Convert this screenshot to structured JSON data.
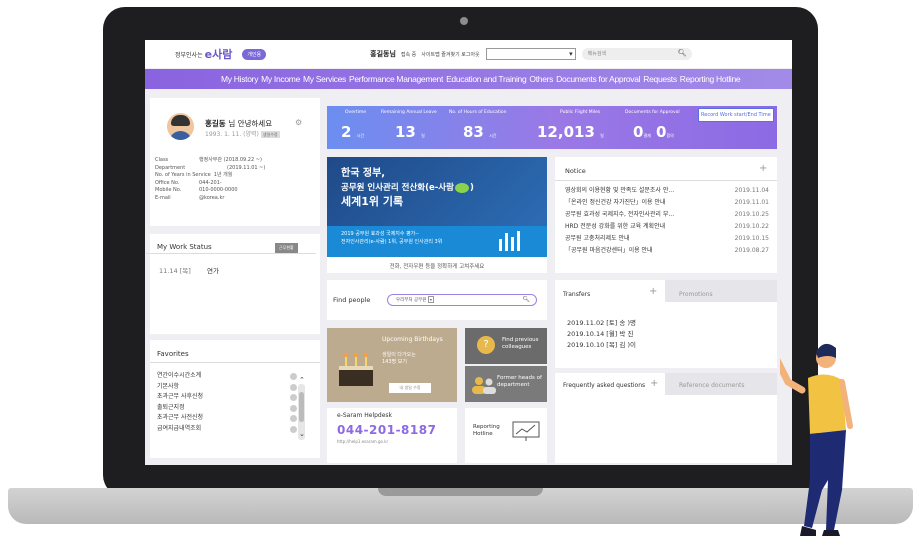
{
  "header": {
    "logo_prefix": "정부인사는",
    "logo": "e사람",
    "badge": "개인용",
    "user": "홍길동님",
    "user_suffix": "접속 중",
    "links": "사이트맵  즐겨찾기  로그아웃",
    "select_placeholder": "",
    "search_placeholder": "메뉴검색"
  },
  "nav": {
    "items": [
      "My History",
      "My Income",
      "My Services",
      "Performance Management",
      "Education and Training",
      "Others",
      "Documents for Approval",
      "Requests",
      "Reporting Hotline"
    ]
  },
  "profile": {
    "name": "홍길동",
    "greeting": "님 안녕하세요",
    "birth": "1993. 1. 11. (양력)",
    "birth_tag": "생일수정",
    "rows": [
      {
        "label": "Class",
        "value": "행정사무관 (2018.09.22 ~)"
      },
      {
        "label": "Department",
        "value": "(2019.11.01 ~)"
      },
      {
        "label": "No. of Years in Service",
        "value": "1년 개월"
      },
      {
        "label": "Office No.",
        "value": "044-201-"
      },
      {
        "label": "Mobile No.",
        "value": "010-0000-0000"
      },
      {
        "label": "E-mail",
        "value": "@korea.kr"
      }
    ]
  },
  "work_status": {
    "title": "My Work Status",
    "button": "근무현황",
    "date": "11.14 [목]",
    "status": "연가"
  },
  "favorites": {
    "title": "Favorites",
    "items": [
      "연간이수시간소계",
      "기본사항",
      "초과근무 사후신청",
      "출퇴근지정",
      "초과근무 사전신청",
      "급여지급내역조회"
    ]
  },
  "stats": {
    "overtime_label": "Overtime",
    "overtime": "2",
    "overtime_unit": "시간",
    "leave_label": "Remaining Annual Leave",
    "leave": "13",
    "leave_unit": "일",
    "edu_label": "No. of Hours of Education",
    "edu": "83",
    "edu_unit": "시간",
    "miles_label": "Public Flight Miles",
    "miles": "12,013",
    "miles_unit": "일",
    "approval_label": "Documents for Approval",
    "approval_a": "0",
    "approval_a_unit": "결재",
    "approval_b": "0",
    "approval_b_unit": "합의",
    "record_button": "Record Work start/End Time"
  },
  "banner": {
    "line1": "한국 정부,",
    "line2": "공무원 인사관리 전산화(e-사람",
    "line2_end": ")",
    "line3": "세계1위 기록",
    "sub1": "2019 공무원 효과성 국제지수 평가--",
    "sub2": "전자인사관리(e-사람) 1위, 공무원 인사관리 3위",
    "caption": "전화, 전자우편 등을 정확하게 고쳐주세요"
  },
  "notice": {
    "title": "Notice",
    "items": [
      {
        "text": "영상회의 이용현황 및 만족도 설문조사 안...",
        "date": "2019.11.04"
      },
      {
        "text": "「온라인 정신건강 자가진단」이용 안내",
        "date": "2019.11.01"
      },
      {
        "text": "공무원 효과성 국제지수, 전자인사관리 부...",
        "date": "2019.10.25"
      },
      {
        "text": "HRD 전문성 강화를 위한 교육 계획안내",
        "date": "2019.10.22"
      },
      {
        "text": "공무원 고충처리제도 안내",
        "date": "2019.10.15"
      },
      {
        "text": "「공무원 마음건강센터」이용 안내",
        "date": "2019.08.27"
      }
    ]
  },
  "find": {
    "title": "Find people",
    "placeholder": "우리부처 공무원"
  },
  "birthdays": {
    "title": "Upcoming Birthdays",
    "sub1": "생일이 다가오는",
    "sub2": "143명 보기",
    "button": "내 생일 수정"
  },
  "colleagues": {
    "title1": "Find previous",
    "title2": "colleagues"
  },
  "former": {
    "title1": "Former heads of",
    "title2": "department"
  },
  "helpdesk": {
    "title": "e-Saram Helpdesk",
    "phone": "044-201-8187",
    "url": "http://help1.esaram.go.kr"
  },
  "hotline": {
    "line1": "Reporting",
    "line2": "Hotline"
  },
  "transfers": {
    "tab1": "Transfers",
    "tab2": "Promotions",
    "items": [
      "2019.11.02 [토] 송 )명",
      "2019.10.14 [월] 박  진",
      "2019.10.10 [목] 김  )이"
    ]
  },
  "faq": {
    "tab1": "Frequently asked questions",
    "tab2": "Reference documents"
  },
  "icons": {
    "settings": "gear-icon",
    "search": "search-icon",
    "plus": "plus-icon"
  },
  "colors": {
    "nav": "#8a63e0",
    "accent": "#6c8ef0",
    "brand": "#6a55c8"
  }
}
